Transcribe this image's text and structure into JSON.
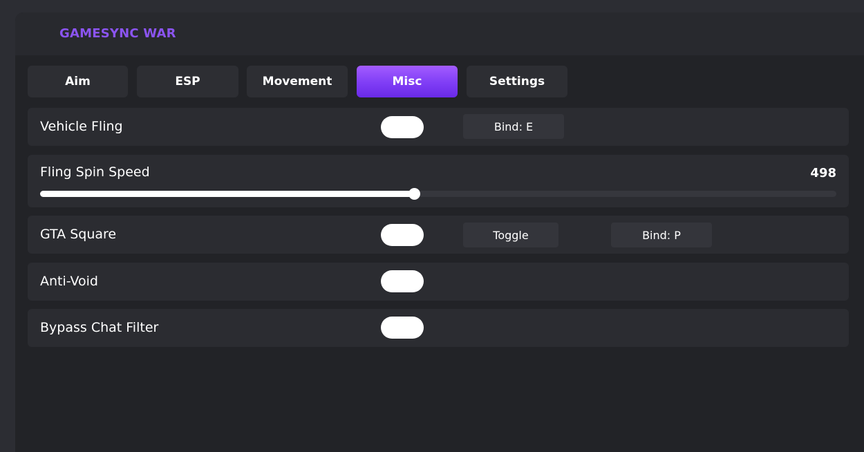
{
  "app": {
    "title": "GAMESYNC WAR",
    "accent": "#8b54f0"
  },
  "tabs": [
    {
      "label": "Aim",
      "active": false
    },
    {
      "label": "ESP",
      "active": false
    },
    {
      "label": "Movement",
      "active": false
    },
    {
      "label": "Misc",
      "active": true
    },
    {
      "label": "Settings",
      "active": false
    }
  ],
  "misc": {
    "vehicle_fling": {
      "label": "Vehicle Fling",
      "enabled": true,
      "bind_label": "Bind: E"
    },
    "fling_spin_speed": {
      "label": "Fling Spin Speed",
      "value": "498",
      "fill_fraction": 0.47
    },
    "gta_square": {
      "label": "GTA Square",
      "enabled": true,
      "mode_label": "Toggle",
      "bind_label": "Bind: P"
    },
    "anti_void": {
      "label": "Anti-Void",
      "enabled": true
    },
    "bypass_chat_filter": {
      "label": "Bypass Chat Filter",
      "enabled": true
    }
  }
}
